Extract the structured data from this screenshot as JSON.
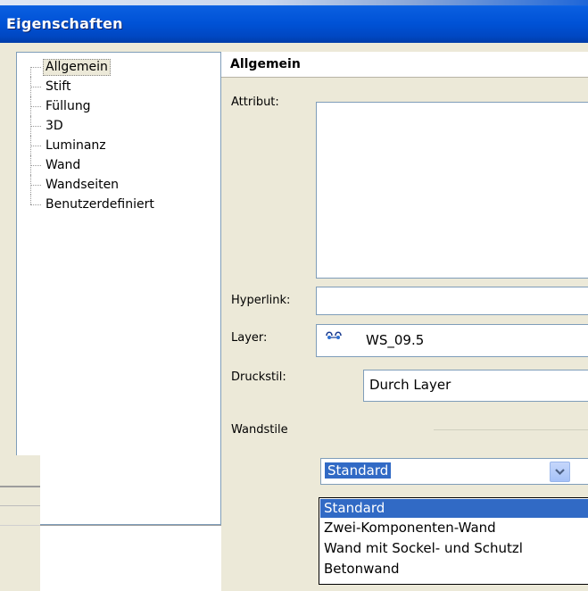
{
  "window": {
    "title": "Eigenschaften"
  },
  "tree": {
    "items": [
      {
        "label": "Allgemein",
        "selected": true
      },
      {
        "label": "Stift"
      },
      {
        "label": "Füllung"
      },
      {
        "label": "3D"
      },
      {
        "label": "Luminanz"
      },
      {
        "label": "Wand"
      },
      {
        "label": "Wandseiten"
      },
      {
        "label": "Benutzerdefiniert"
      }
    ]
  },
  "section": {
    "title": "Allgemein"
  },
  "fields": {
    "attribut_label": "Attribut:",
    "attribut_value": "",
    "hyperlink_label": "Hyperlink:",
    "hyperlink_value": "",
    "layer_label": "Layer:",
    "layer_value": "WS_09.5",
    "druckstil_label": "Druckstil:",
    "druckstil_value": "Durch Layer",
    "wandstile_label": "Wandstile"
  },
  "wandstile_combo": {
    "selected": "Standard",
    "options": [
      {
        "label": "Standard",
        "highlighted": true
      },
      {
        "label": "Zwei-Komponenten-Wand"
      },
      {
        "label": "Wand mit Sockel- und Schutzl"
      },
      {
        "label": "Betonwand"
      }
    ]
  },
  "colors": {
    "titlebar": "#0052d6",
    "selection": "#316ac5",
    "dialog_bg": "#ece9d8",
    "field_border": "#7f9db9"
  },
  "icons": {
    "layer": "layer-icon",
    "dropdown": "chevron-down-icon"
  }
}
